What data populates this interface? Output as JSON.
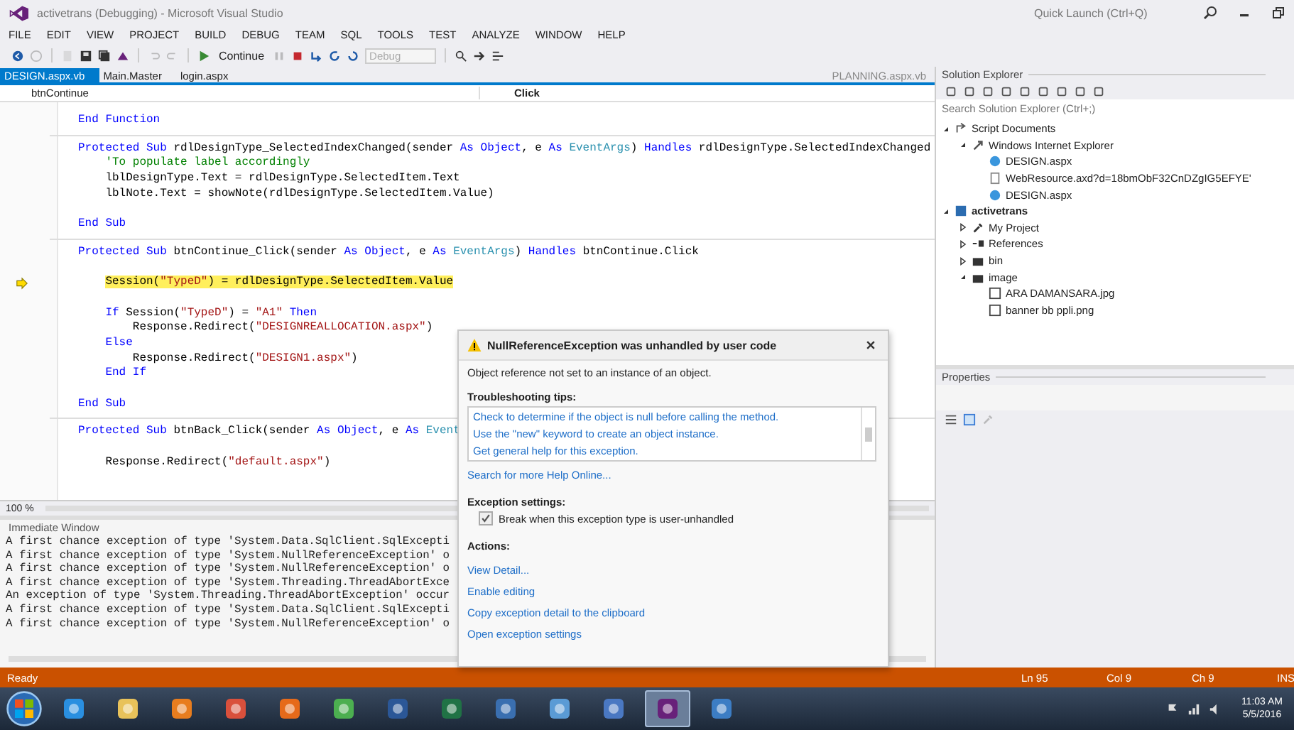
{
  "window": {
    "title": "activetrans (Debugging) - Microsoft Visual Studio",
    "quick_launch_placeholder": "Quick Launch (Ctrl+Q)"
  },
  "menu": [
    "FILE",
    "EDIT",
    "VIEW",
    "PROJECT",
    "BUILD",
    "DEBUG",
    "TEAM",
    "SQL",
    "TOOLS",
    "TEST",
    "ANALYZE",
    "WINDOW",
    "HELP"
  ],
  "toolbar": {
    "continue_label": "Continue",
    "configuration": {
      "value": "Debug",
      "disabled": true
    }
  },
  "document_tabs": [
    {
      "label": "DESIGN.aspx.vb",
      "selected": true
    },
    {
      "label": "Main.Master",
      "selected": false
    },
    {
      "label": "login.aspx",
      "selected": false
    }
  ],
  "preview_tab": {
    "label": "PLANNING.aspx.vb"
  },
  "navigation_bar": {
    "type_member": "btnContinue",
    "method": "Click"
  },
  "editor": {
    "zoom": "100 %",
    "blocks": [
      {
        "lines": [
          {
            "kind": "code",
            "segments": [
              {
                "kind": "kw",
                "text": "End Function"
              }
            ]
          }
        ]
      },
      {
        "lines": [
          {
            "kind": "code",
            "segments": [
              {
                "kind": "kw",
                "text": "Protected Sub "
              },
              {
                "kind": "plain",
                "text": "rdlDesignType_SelectedIndexChanged(sender "
              },
              {
                "kind": "kw",
                "text": "As Object"
              },
              {
                "kind": "plain",
                "text": ", e "
              },
              {
                "kind": "kw",
                "text": "As "
              },
              {
                "kind": "type",
                "text": "EventArgs"
              },
              {
                "kind": "plain",
                "text": ") "
              },
              {
                "kind": "kw",
                "text": "Handles "
              },
              {
                "kind": "plain",
                "text": "rdlDesignType.SelectedIndexChanged"
              }
            ]
          },
          {
            "kind": "code",
            "segments": [
              {
                "kind": "cmt",
                "text": "    'To populate label accordingly"
              }
            ]
          },
          {
            "kind": "code",
            "segments": [
              {
                "kind": "plain",
                "text": "    lblDesignType.Text = rdlDesignType.SelectedItem.Text"
              }
            ]
          },
          {
            "kind": "code",
            "segments": [
              {
                "kind": "plain",
                "text": "    lblNote.Text = showNote(rdlDesignType.SelectedItem.Value)"
              }
            ]
          },
          {
            "kind": "blank"
          },
          {
            "kind": "code",
            "segments": [
              {
                "kind": "kw",
                "text": "End Sub"
              }
            ]
          }
        ]
      },
      {
        "lines": [
          {
            "kind": "code",
            "segments": [
              {
                "kind": "kw",
                "text": "Protected Sub "
              },
              {
                "kind": "plain",
                "text": "btnContinue_Click(sender "
              },
              {
                "kind": "kw",
                "text": "As Object"
              },
              {
                "kind": "plain",
                "text": ", e "
              },
              {
                "kind": "kw",
                "text": "As "
              },
              {
                "kind": "type",
                "text": "EventArgs"
              },
              {
                "kind": "plain",
                "text": ") "
              },
              {
                "kind": "kw",
                "text": "Handles "
              },
              {
                "kind": "plain",
                "text": "btnContinue.Click"
              }
            ]
          },
          {
            "kind": "blank"
          },
          {
            "kind": "code",
            "current": true,
            "segments": [
              {
                "kind": "plain",
                "text": "    Session("
              },
              {
                "kind": "str",
                "text": "\"TypeD\""
              },
              {
                "kind": "plain",
                "text": ") = rdlDesignType.SelectedItem.Value"
              }
            ]
          },
          {
            "kind": "blank"
          },
          {
            "kind": "code",
            "segments": [
              {
                "kind": "kw",
                "text": "    If "
              },
              {
                "kind": "plain",
                "text": "Session("
              },
              {
                "kind": "str",
                "text": "\"TypeD\""
              },
              {
                "kind": "plain",
                "text": ") = "
              },
              {
                "kind": "str",
                "text": "\"A1\""
              },
              {
                "kind": "kw",
                "text": " Then"
              }
            ]
          },
          {
            "kind": "code",
            "segments": [
              {
                "kind": "plain",
                "text": "        Response.Redirect("
              },
              {
                "kind": "str",
                "text": "\"DESIGNREALLOCATION.aspx\""
              },
              {
                "kind": "plain",
                "text": ")"
              }
            ]
          },
          {
            "kind": "code",
            "segments": [
              {
                "kind": "kw",
                "text": "    Else"
              }
            ]
          },
          {
            "kind": "code",
            "segments": [
              {
                "kind": "plain",
                "text": "        Response.Redirect("
              },
              {
                "kind": "str",
                "text": "\"DESIGN1.aspx\""
              },
              {
                "kind": "plain",
                "text": ")"
              }
            ]
          },
          {
            "kind": "code",
            "segments": [
              {
                "kind": "kw",
                "text": "    End If"
              }
            ]
          },
          {
            "kind": "blank"
          },
          {
            "kind": "code",
            "segments": [
              {
                "kind": "kw",
                "text": "End Sub"
              }
            ]
          }
        ]
      },
      {
        "lines": [
          {
            "kind": "code",
            "segments": [
              {
                "kind": "kw",
                "text": "Protected Sub "
              },
              {
                "kind": "plain",
                "text": "btnBack_Click(sender "
              },
              {
                "kind": "kw",
                "text": "As Object"
              },
              {
                "kind": "plain",
                "text": ", e "
              },
              {
                "kind": "kw",
                "text": "As "
              },
              {
                "kind": "type",
                "text": "Event"
              }
            ]
          },
          {
            "kind": "blank"
          },
          {
            "kind": "code",
            "segments": [
              {
                "kind": "plain",
                "text": "    Response.Redirect("
              },
              {
                "kind": "str",
                "text": "\"default.aspx\""
              },
              {
                "kind": "plain",
                "text": ")"
              }
            ]
          }
        ]
      }
    ]
  },
  "immediate_window": {
    "title": "Immediate Window",
    "lines": [
      "A first chance exception of type 'System.Data.SqlClient.SqlExcepti",
      "A first chance exception of type 'System.NullReferenceException' o",
      "A first chance exception of type 'System.NullReferenceException' o",
      "A first chance exception of type 'System.Threading.ThreadAbortExce",
      "An exception of type 'System.Threading.ThreadAbortException' occur",
      "A first chance exception of type 'System.Data.SqlClient.SqlExcepti",
      "A first chance exception of type 'System.NullReferenceException' o"
    ]
  },
  "exception_popup": {
    "title": "NullReferenceException was unhandled by user code",
    "message": "Object reference not set to an instance of an object.",
    "tips_heading": "Troubleshooting tips:",
    "tips": [
      "Check to determine if the object is null before calling the method.",
      "Use the \"new\" keyword to create an object instance.",
      "Get general help for this exception."
    ],
    "help_link": "Search for more Help Online...",
    "settings_heading": "Exception settings:",
    "break_option": {
      "label": "Break when this exception type is user-unhandled",
      "checked": true
    },
    "actions_heading": "Actions:",
    "actions": [
      "View Detail...",
      "Enable editing",
      "Copy exception detail to the clipboard",
      "Open exception settings"
    ]
  },
  "solution_explorer": {
    "title": "Solution Explorer",
    "search_placeholder": "Search Solution Explorer (Ctrl+;)",
    "tree": [
      {
        "label": "Script Documents",
        "kind": "scripts",
        "expanded": true,
        "bold": false,
        "children": [
          {
            "label": "Windows Internet Explorer",
            "kind": "browser",
            "expanded": true,
            "bold": false,
            "children": [
              {
                "label": "DESIGN.aspx",
                "kind": "page",
                "expanded": false,
                "bold": false
              },
              {
                "label": "WebResource.axd?d=18bmObF32CnDZgIG5EFYE'",
                "kind": "file",
                "expanded": false,
                "bold": false
              },
              {
                "label": "DESIGN.aspx",
                "kind": "page",
                "expanded": false,
                "bold": false
              }
            ]
          }
        ]
      },
      {
        "label": "activetrans",
        "kind": "project",
        "expanded": true,
        "bold": true,
        "children": [
          {
            "label": "My Project",
            "kind": "wrench",
            "expanded": false,
            "bold": false
          },
          {
            "label": "References",
            "kind": "refs",
            "expanded": false,
            "bold": false
          },
          {
            "label": "bin",
            "kind": "folder",
            "expanded": false,
            "bold": false
          },
          {
            "label": "image",
            "kind": "folder",
            "expanded": true,
            "bold": false,
            "children": [
              {
                "label": "ARA DAMANSARA.jpg",
                "kind": "image",
                "expanded": false,
                "bold": false
              },
              {
                "label": "banner bb ppli.png",
                "kind": "image",
                "expanded": false,
                "bold": false
              }
            ]
          }
        ]
      }
    ]
  },
  "properties": {
    "title": "Properties"
  },
  "status_bar": {
    "state": "Ready",
    "line": "Ln 95",
    "column": "Col 9",
    "char": "Ch 9",
    "mode": "INS"
  },
  "taskbar": {
    "apps": [
      {
        "kind": "ie",
        "selected": false
      },
      {
        "kind": "folder",
        "selected": false
      },
      {
        "kind": "media",
        "selected": false
      },
      {
        "kind": "paint",
        "selected": false
      },
      {
        "kind": "firefox",
        "selected": false
      },
      {
        "kind": "chrome",
        "selected": false
      },
      {
        "kind": "word",
        "selected": false
      },
      {
        "kind": "excel",
        "selected": false
      },
      {
        "kind": "window",
        "selected": false
      },
      {
        "kind": "network",
        "selected": false
      },
      {
        "kind": "grid",
        "selected": false
      },
      {
        "kind": "vs",
        "selected": true
      },
      {
        "kind": "remote",
        "selected": false
      }
    ],
    "time": "11:03 AM",
    "date": "5/5/2016"
  }
}
